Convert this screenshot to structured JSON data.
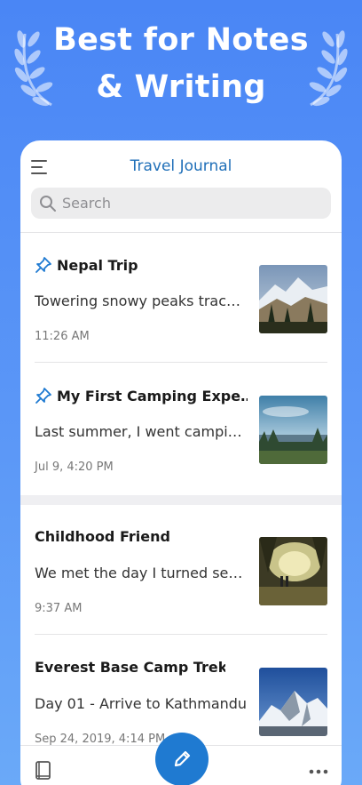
{
  "hero": {
    "line1": "Best for Notes",
    "line2": "& Writing"
  },
  "app": {
    "title": "Travel Journal"
  },
  "search": {
    "placeholder": "Search"
  },
  "notes": [
    {
      "title": "Nepal Trip",
      "snippet": "Towering snowy peaks trac…",
      "time": "11:26 AM",
      "pinned": true,
      "thumb": "mountain-forest-photo"
    },
    {
      "title": "My First Camping Expe…",
      "snippet": "Last summer, I went campi…",
      "time": "Jul 9, 4:20 PM",
      "pinned": true,
      "thumb": "lake-forest-photo"
    },
    {
      "title": "Childhood Friend",
      "snippet": "We met the day I turned se…",
      "time": "9:37 AM",
      "pinned": false,
      "thumb": "park-walk-photo"
    },
    {
      "title": "Everest Base Camp Trek",
      "snippet": "Day 01 - Arrive to Kathmandu",
      "time": "Sep 24, 2019, 4:14 PM",
      "pinned": false,
      "thumb": "snow-mountain-photo"
    }
  ],
  "icons": {
    "menu": "menu-icon",
    "search": "search-icon",
    "pin": "pin-icon",
    "book": "book-icon",
    "compose": "pencil-icon",
    "more": "more-icon"
  },
  "colors": {
    "background": "#4a86f5",
    "accent": "#1f7ad1",
    "title": "#1f6fb8"
  }
}
